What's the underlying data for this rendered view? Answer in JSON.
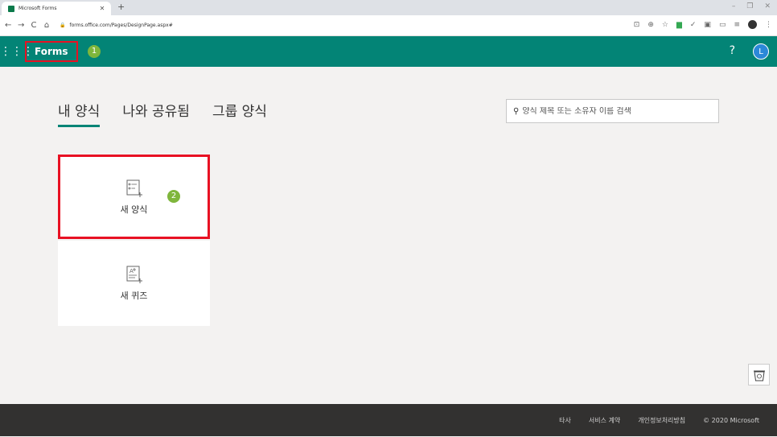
{
  "browser": {
    "tab_title": "Microsoft Forms",
    "url": "forms.office.com/Pages/DesignPage.aspx#"
  },
  "header": {
    "brand": "Forms",
    "step1": "1",
    "help": "?",
    "avatar_initial": "L",
    "color": "#038476"
  },
  "tabs": [
    {
      "label": "내 양식",
      "active": true
    },
    {
      "label": "나와 공유됨",
      "active": false
    },
    {
      "label": "그룹 양식",
      "active": false
    }
  ],
  "search": {
    "placeholder": "양식 제목 또는 소유자 이름 검색"
  },
  "cards": {
    "new_form": "새 양식",
    "new_quiz": "새 퀴즈",
    "step2": "2"
  },
  "footer": {
    "items": [
      "타사",
      "서비스 계약",
      "개인정보처리방침",
      "© 2020 Microsoft"
    ]
  },
  "colors": {
    "highlight_box": "#e81123",
    "step_badge": "#7fb63c"
  }
}
